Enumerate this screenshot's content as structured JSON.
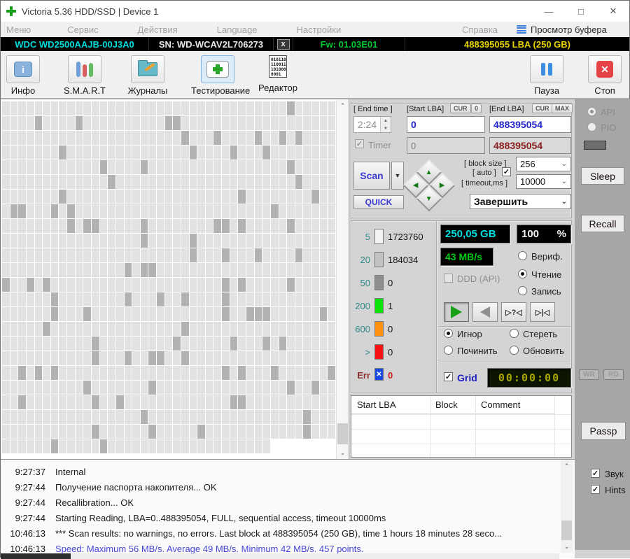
{
  "window": {
    "title": "Victoria 5.36 HDD/SSD | Device 1",
    "minimize": "—",
    "maximize": "□",
    "close": "✕"
  },
  "menu": {
    "items": [
      "Меню",
      "Сервис",
      "Действия",
      "Language",
      "Настройки",
      "Справка"
    ],
    "buffer_view": "Просмотр буфера"
  },
  "device_bar": {
    "model": "WDC WD2500AAJB-00J3A0",
    "serial": "SN: WD-WCAV2L706273",
    "close_btn": "x",
    "firmware": "Fw: 01.03E01",
    "capacity": "488395055 LBA (250 GB)"
  },
  "toolbar": {
    "info": "Инфо",
    "smart": "S.M.A.R.T",
    "journals": "Журналы",
    "testing": "Тестирование",
    "editor": "Редактор",
    "pause": "Пауза",
    "stop": "Стоп",
    "editor_icon_lines": [
      "010110",
      "110011",
      "101000",
      "0001"
    ]
  },
  "scan_panel": {
    "end_time_label": "[ End time ]",
    "end_time": "2:24",
    "timer_label": "Timer",
    "start_lba_label": "[Start LBA]",
    "cur_label": "CUR",
    "zero_label": "0",
    "start_lba": "0",
    "start_lba_shadow": "0",
    "end_lba_label": "[End LBA]",
    "max_label": "MAX",
    "end_lba": "488395054",
    "end_lba_shadow": "488395054",
    "scan_label": "Scan",
    "quick_label": "QUICK",
    "block_size_label": "[ block size ]",
    "block_size": "256",
    "auto_label": "[ auto ]",
    "timeout_label": "[ timeout,ms ]",
    "timeout": "10000",
    "after_action": "Завершить"
  },
  "stats": {
    "rows": [
      {
        "label": "5",
        "value": "1723760",
        "color": "#f4f4f4"
      },
      {
        "label": "20",
        "value": "184034",
        "color": "#c2c2c2"
      },
      {
        "label": "50",
        "value": "0",
        "color": "#8e8e8e"
      },
      {
        "label": "200",
        "value": "1",
        "color": "#0ae40a"
      },
      {
        "label": "600",
        "value": "0",
        "color": "#ff9010"
      },
      {
        "label": ">",
        "value": "0",
        "color": "#f81212"
      },
      {
        "label": "Err",
        "value": "0",
        "color": "#1846e0"
      }
    ],
    "err_mark": "✕"
  },
  "monitor": {
    "capacity": "250,05 GB",
    "percent": "100",
    "percent_unit": "%",
    "speed": "43 MB/s",
    "ddd_label": "DDD (API)",
    "mode_verify": "Вериф.",
    "mode_read": "Чтение",
    "mode_write": "Запись"
  },
  "nav": {
    "skip_glyph": "▷?◁",
    "end_glyph": "▷|◁"
  },
  "actions": {
    "ignore": "Игнор",
    "erase": "Стереть",
    "remap": "Починить",
    "refresh": "Обновить",
    "grid_label": "Grid",
    "elapsed": "00:00:00"
  },
  "defect_table": {
    "headers": [
      "Start LBA",
      "Block",
      "Comment"
    ]
  },
  "side": {
    "api": "API",
    "pio": "PIO",
    "sleep": "Sleep",
    "recall": "Recall",
    "wr": "WR",
    "rd": "RD",
    "passp": "Passp",
    "sound": "Звук",
    "hints": "Hints"
  },
  "log": {
    "entries": [
      {
        "time": "9:27:37",
        "text": "Internal",
        "color": "#1a1a1a"
      },
      {
        "time": "9:27:44",
        "text": "Получение паспорта накопителя... OK",
        "color": "#1a1a1a"
      },
      {
        "time": "9:27:44",
        "text": "Recallibration... OK",
        "color": "#1a1a1a"
      },
      {
        "time": "9:27:44",
        "text": "Starting Reading, LBA=0..488395054, FULL, sequential access, timeout 10000ms",
        "color": "#1a1a1a"
      },
      {
        "time": "10:46:13",
        "text": "*** Scan results: no warnings, no errors. Last block at 488395054 (250 GB), time 1 hours 18 minutes 28 seco...",
        "color": "#1a1a1a"
      },
      {
        "time": "10:46:13",
        "text": "Speed: Maximum 56 MB/s. Average 49 MB/s. Minimum 42 MB/s. 457 points.",
        "color": "#4845d8"
      }
    ]
  },
  "map": {
    "cols": 41,
    "rows": 24,
    "last_row_cells": 33,
    "dark_ratio": 0.095,
    "seed": 20,
    "light_color": "#e2e2e2",
    "dark_color": "#b2b2b2"
  },
  "colors": {
    "lcd_cyan": "#00dede",
    "lcd_green": "#00cc10",
    "lcd_white": "#f2f2f2",
    "lcd_amber": "#a8a400"
  }
}
